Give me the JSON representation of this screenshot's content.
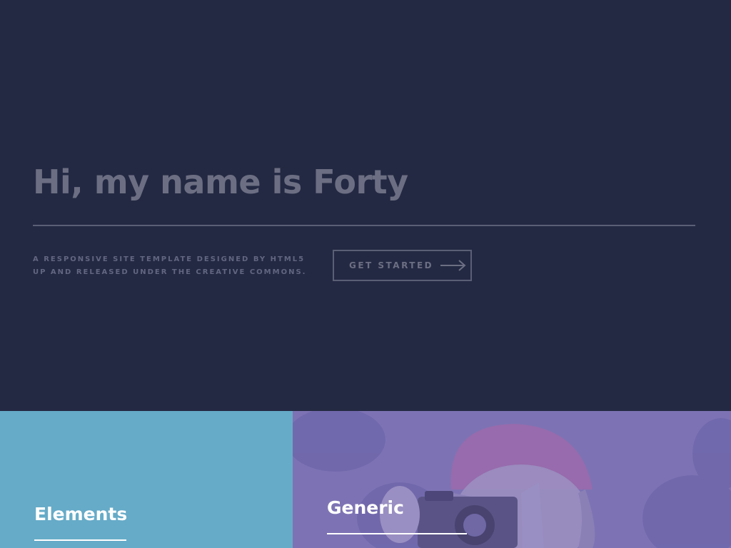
{
  "banner": {
    "title": "Hi, my name is Forty",
    "description": "A responsive site template designed by HTML5 UP and released under the Creative Commons.",
    "button_label": "Get Started",
    "button_icon": "arrow-right-icon"
  },
  "tiles": [
    {
      "title": "Elements",
      "color": "#66abc8"
    },
    {
      "title": "Generic",
      "color": "#7d73b4"
    }
  ],
  "colors": {
    "background": "#242943",
    "accent_elements": "#66abc8",
    "accent_generic": "#7d73b4",
    "text_muted": "#6c6f83"
  }
}
